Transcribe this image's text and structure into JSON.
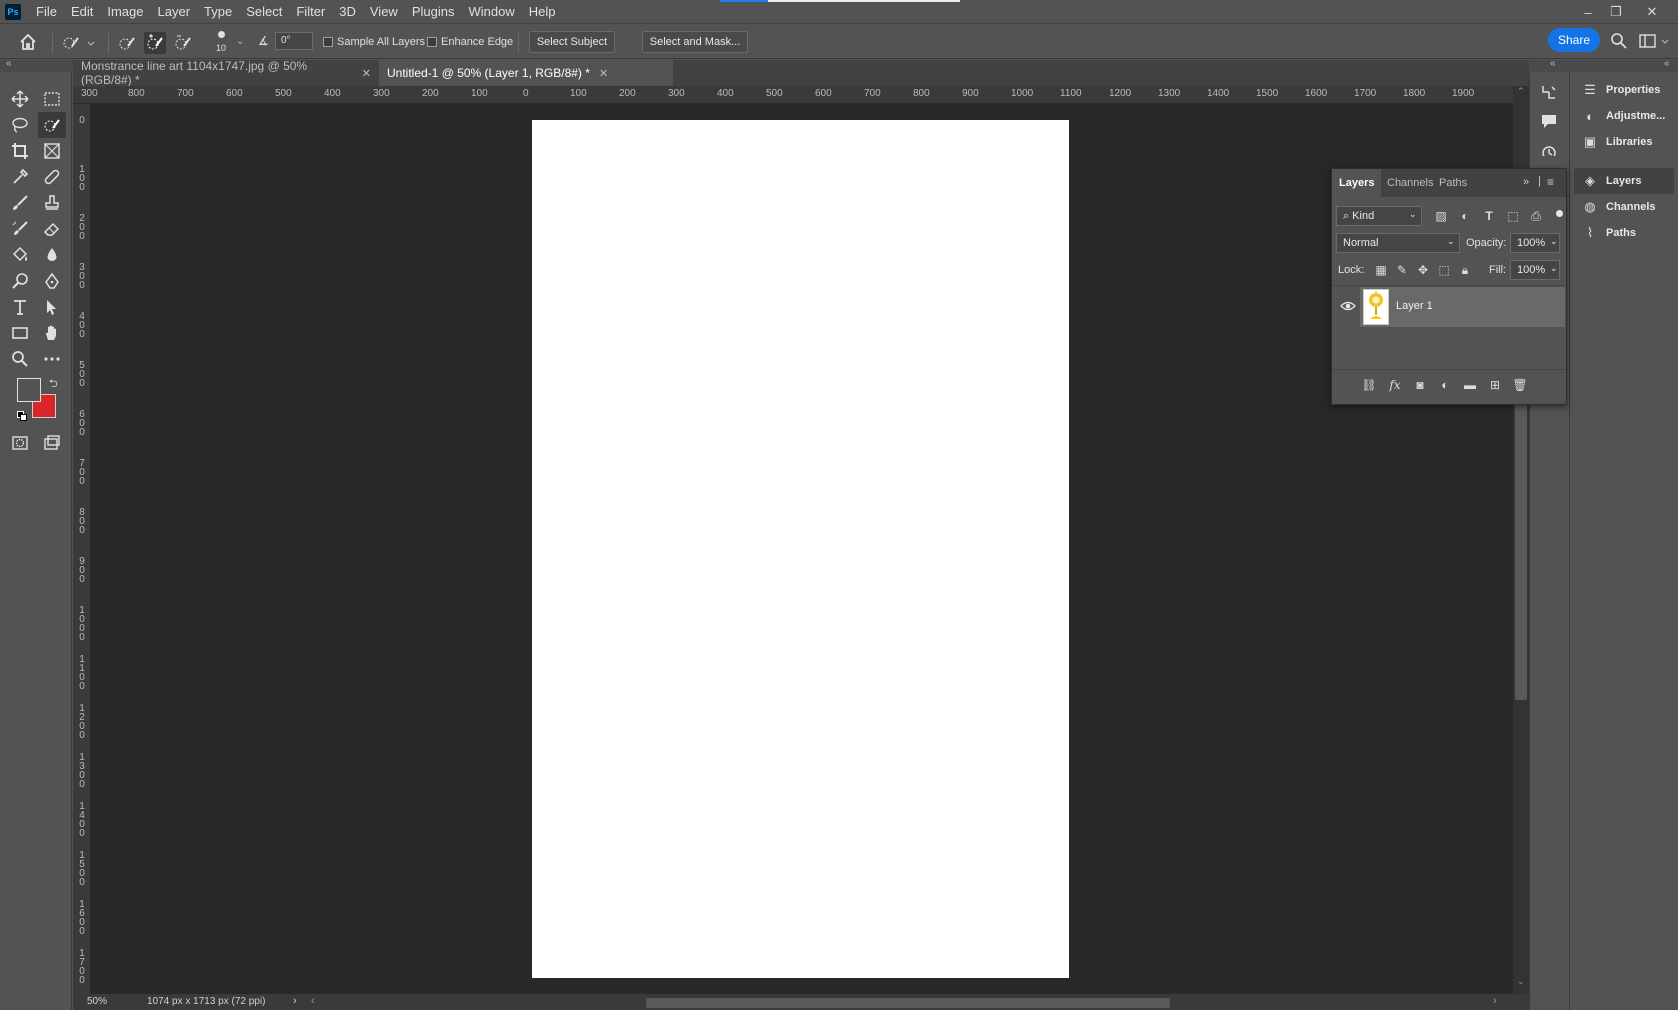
{
  "app": {
    "logo": "Ps"
  },
  "menu": [
    "File",
    "Edit",
    "Image",
    "Layer",
    "Type",
    "Select",
    "Filter",
    "3D",
    "View",
    "Plugins",
    "Window",
    "Help"
  ],
  "window_controls": {
    "minimize": "‒",
    "restore": "❐",
    "close": "✕"
  },
  "options_bar": {
    "brush_size": "10",
    "angle": "0°",
    "sample_all_layers": "Sample All Layers",
    "enhance_edge": "Enhance Edge",
    "select_subject": "Select Subject",
    "select_and_mask": "Select and Mask...",
    "share": "Share"
  },
  "doc_tabs": [
    {
      "label": "Monstrance line art 1104x1747.jpg @ 50% (RGB/8#) *",
      "active": false
    },
    {
      "label": "Untitled-1 @ 50% (Layer 1, RGB/8#) *",
      "active": true
    }
  ],
  "ruler_h": [
    "300",
    "800",
    "700",
    "600",
    "500",
    "400",
    "300",
    "200",
    "100",
    "0",
    "100",
    "200",
    "300",
    "400",
    "500",
    "600",
    "700",
    "800",
    "900",
    "1000",
    "1100",
    "1200",
    "1300",
    "1400",
    "1500",
    "1600",
    "1700",
    "1800",
    "1900"
  ],
  "ruler_v": [
    "0",
    "1\n0\n0",
    "2\n0\n0",
    "3\n0\n0",
    "4\n0\n0",
    "5\n0\n0",
    "6\n0\n0",
    "7\n0\n0",
    "8\n0\n0",
    "9\n0\n0",
    "1\n0\n0\n0",
    "1\n1\n0\n0",
    "1\n2\n0\n0",
    "1\n3\n0\n0",
    "1\n4\n0\n0",
    "1\n5\n0\n0",
    "1\n6\n0\n0",
    "1\n7\n0\n0"
  ],
  "status": {
    "zoom": "50%",
    "doc_info": "1074 px x 1713 px (72 ppi)"
  },
  "colors": {
    "foreground": "#535353",
    "background": "#d9262a",
    "accent": "#1473e6"
  },
  "layers_panel": {
    "tabs": [
      "Layers",
      "Channels",
      "Paths"
    ],
    "filter_kind": "Kind",
    "blend_mode": "Normal",
    "opacity_label": "Opacity:",
    "opacity": "100%",
    "lock_label": "Lock:",
    "fill_label": "Fill:",
    "fill": "100%",
    "layers": [
      {
        "name": "Layer 1",
        "visible": true
      }
    ]
  },
  "dock": [
    "Properties",
    "Adjustme...",
    "Libraries",
    "Layers",
    "Channels",
    "Paths"
  ]
}
